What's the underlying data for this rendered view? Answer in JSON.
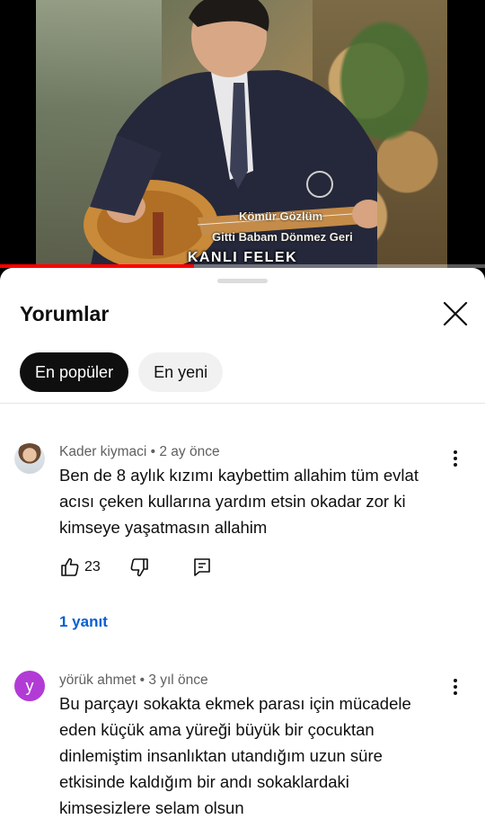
{
  "video": {
    "title_overlay": "KANLI FELEK",
    "song_lines": [
      "Kömür Gözlüm",
      "Gitti Babam Dönmez Geri"
    ],
    "progress_percent": 40
  },
  "sheet": {
    "title": "Yorumlar",
    "close_icon": "close-icon",
    "chips": [
      {
        "label": "En popüler",
        "active": true
      },
      {
        "label": "En yeni",
        "active": false
      }
    ]
  },
  "comments": [
    {
      "author": "Kader kiymaci",
      "time": "2 ay önce",
      "meta": "Kader kiymaci • 2 ay önce",
      "text_lines": [
        "Ben de 8 aylık kızımı kaybettim allahim tüm evlat",
        "acısı çeken kullarına yardım etsin okadar zor ki",
        "kimseye yaşatmasın allahim"
      ],
      "likes": "23",
      "replies_label": "1 yanıt"
    },
    {
      "author": "yörük ahmet",
      "time": "3 yıl önce",
      "meta": "yörük ahmet • 3 yıl önce",
      "avatar_letter": "y",
      "avatar_color": "#b23bd6",
      "text_lines": [
        "Bu parçayı sokakta ekmek parası için mücadele",
        "eden küçük ama yüreği büyük bir çocuktan",
        "dinlemiştim insanlıktan utandığım uzun süre",
        "etkisinde kaldığım bir andı sokaklardaki",
        "kimsesizlere selam olsun"
      ]
    }
  ],
  "colors": {
    "progress": "#ff0000",
    "reply_link": "#065fd4",
    "active_chip": "#0f0f0f"
  }
}
